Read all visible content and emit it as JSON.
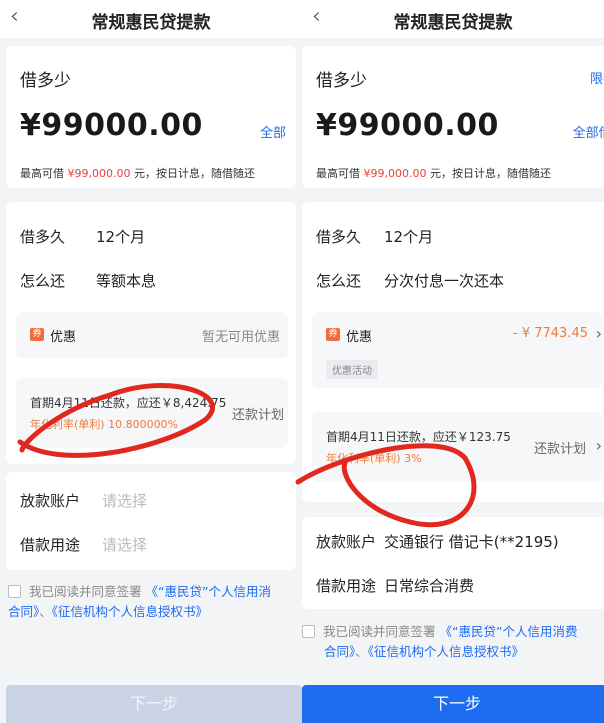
{
  "left": {
    "title": "常规惠民贷提款",
    "back_glyph": "‹",
    "amount_section": {
      "label": "借多少",
      "amount": "¥99000.00",
      "all_link": "全部",
      "max_note_prefix": "最高可借",
      "max_note_amount": "¥99,000.00",
      "max_note_suffix": "元，按日计息，随借随还"
    },
    "term": {
      "label": "借多久",
      "value": "12个月"
    },
    "repay": {
      "label": "怎么还",
      "value": "等额本息"
    },
    "promo": {
      "icon": "券",
      "label": "优惠",
      "value": "暂无可用优惠"
    },
    "plan": {
      "line": "首期4月11日还款，应还￥8,424.75",
      "rate": "年化利率(单利) 10.800000%",
      "link": "还款计划"
    },
    "account": {
      "label": "放款账户",
      "placeholder": "请选择"
    },
    "purpose": {
      "label": "借款用途",
      "placeholder": "请选择"
    },
    "agreement": {
      "text1": "我已阅读并同意签署",
      "link1": "《“惠民贷”个人信用消费合同》",
      "sep": "、",
      "link2": "《征信机构个人信息授权书》",
      "line1_link": "《“惠民贷”个人信用消",
      "line2_link": "合同》"
    },
    "next_button": "下一步"
  },
  "right": {
    "title": "常规惠民贷提款",
    "back_glyph": "‹",
    "amount_section": {
      "label": "借多少",
      "limit_link": "限额",
      "amount": "¥99000.00",
      "all_link": "全部借:",
      "max_note_prefix": "最高可借",
      "max_note_amount": "¥99,000.00",
      "max_note_suffix": "元，按日计息，随借随还"
    },
    "term": {
      "label": "借多久",
      "value": "12个月"
    },
    "repay": {
      "label": "怎么还",
      "value": "分次付息一次还本"
    },
    "promo": {
      "icon": "券",
      "label": "优惠",
      "value": "- ¥ 7743.45",
      "tag": "优惠活动"
    },
    "plan": {
      "line": "首期4月11日还款，应还￥123.75",
      "rate": "年化利率(单利) 3%",
      "link": "还款计划"
    },
    "account": {
      "label": "放款账户",
      "value": "交通银行 借记卡(**2195)"
    },
    "purpose": {
      "label": "借款用途",
      "value": "日常综合消费"
    },
    "agreement": {
      "text1": "我已阅读并同意签署",
      "line1_link": "《“惠民贷”个人信用消费",
      "line2_link": "合同》",
      "sep": "、",
      "link2": "《征信机构个人信息授权书》"
    },
    "next_button": "下一步"
  },
  "colors": {
    "brand_blue": "#1e6cf2",
    "highlight_red": "#e8423a",
    "rate_orange": "#f07a3a",
    "disabled_button": "#c9d3e3",
    "scribble_red": "#e0281e"
  }
}
